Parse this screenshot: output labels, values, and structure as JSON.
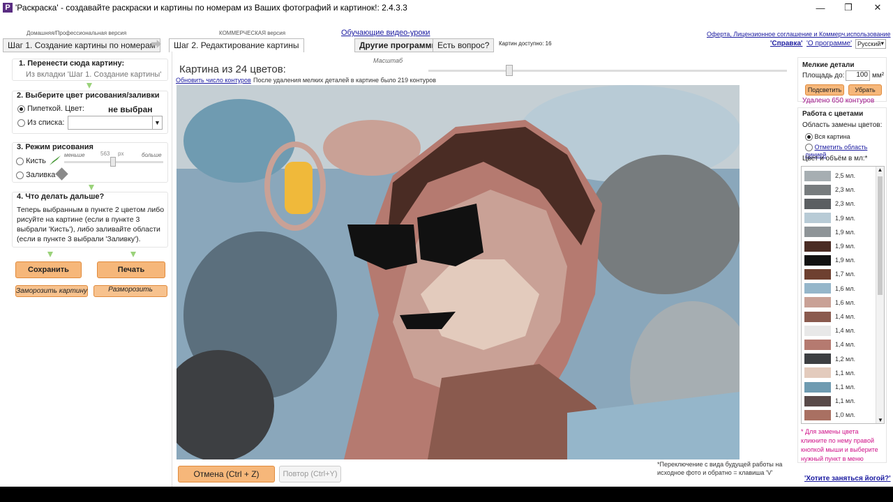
{
  "title": "'Раскраска' - создавайте раскраски и картины по номерам из Ваших фотографий и картинок!: 2.4.3.3",
  "version_home": "Домашняя/Профессиональная версия",
  "version_commercial": "КОММЕРЧЕСКАЯ версия",
  "tab1": "Шаг 1. Создание картины по номерам",
  "tab2": "Шаг 2. Редактирование картины",
  "video_link": "Обучающие видео-уроки",
  "other_programs": "Другие программы",
  "question": "Есть вопрос?",
  "pictures_available": "Картин доступно: 16",
  "offer_link": "Оферта, Лицензионное соглашение и Коммерч.использование",
  "help_link": "'Справка'",
  "about_link": "'О программе'",
  "language": "Русский",
  "s1_title": "1. Перенести сюда картину:",
  "s1_text": "Из вкладки 'Шаг 1. Создание картины'",
  "s2_title": "2. Выберите цвет рисования/заливки",
  "s2_pipette": "Пипеткой. Цвет:",
  "s2_notselected": "не выбран",
  "s2_list": "Из списка:",
  "s3_title": "3. Режим рисования",
  "s3_brush": "Кисть",
  "s3_fill": "Заливка",
  "s3_less": "меньше",
  "s3_more": "больше",
  "s3_size": "563",
  "s3_px": "px",
  "s4_title": "4. Что делать дальше?",
  "s4_text": "Теперь выбранным в пункте 2 цветом либо рисуйте на картине (если в пункте 3 выбрали 'Кисть'), либо заливайте области (если в пункте 3 выбрали 'Заливку').",
  "save": "Сохранить",
  "print": "Печать",
  "freeze": "Заморозить картину",
  "unfreeze": "Разморозить",
  "picture_heading": "Картина из 24 цветов:",
  "scale": "Масштаб",
  "refresh_link": "Обновить число контуров",
  "contours_info": "После удаления мелких деталей в картине было 219 контуров",
  "undo": "Отмена (Ctrl + Z)",
  "redo": "Повтор (Ctrl+Y)",
  "hint_v": "*Переключение с вида будущей работы на исходное фото и обратно = клавиша 'V'",
  "small_details": "Мелкие детали",
  "area_label": "Площадь до:",
  "area_value": "100",
  "area_unit": "мм²",
  "highlight": "Подсветить",
  "remove": "Убрать",
  "removed": "Удалено 650 контуров",
  "colors_title": "Работа с цветами",
  "replace_area": "Область замены цветов:",
  "whole_picture": "Вся картина",
  "mark_area": "Отметить область линией",
  "color_volume": "Цвет и объём в мл:*",
  "colors": [
    {
      "color": "#a6aeb2",
      "label": "2,5 мл."
    },
    {
      "color": "#777c7e",
      "label": "2,3 мл."
    },
    {
      "color": "#5b5f62",
      "label": "2,3 мл."
    },
    {
      "color": "#b8cbd6",
      "label": "1,9 мл."
    },
    {
      "color": "#8e9497",
      "label": "1,9 мл."
    },
    {
      "color": "#4a2c24",
      "label": "1,9 мл."
    },
    {
      "color": "#111111",
      "label": "1,9 мл."
    },
    {
      "color": "#6e4030",
      "label": "1,7 мл."
    },
    {
      "color": "#95b6ca",
      "label": "1,6 мл."
    },
    {
      "color": "#c9a196",
      "label": "1,6 мл."
    },
    {
      "color": "#8a5a4e",
      "label": "1,4 мл."
    },
    {
      "color": "#e8e8e8",
      "label": "1,4 мл."
    },
    {
      "color": "#b57a70",
      "label": "1,4 мл."
    },
    {
      "color": "#3d3f42",
      "label": "1,2 мл."
    },
    {
      "color": "#e3cbbd",
      "label": "1,1 мл."
    },
    {
      "color": "#6f9bb1",
      "label": "1,1 мл."
    },
    {
      "color": "#594a49",
      "label": "1,1 мл."
    },
    {
      "color": "#a97062",
      "label": "1,0 мл."
    }
  ],
  "colors_note": "* Для замены цвета кликните по нему правой кнопкой мыши и выберите нужный пункт в меню",
  "yoga_link": "'Хотите заняться йогой?'"
}
